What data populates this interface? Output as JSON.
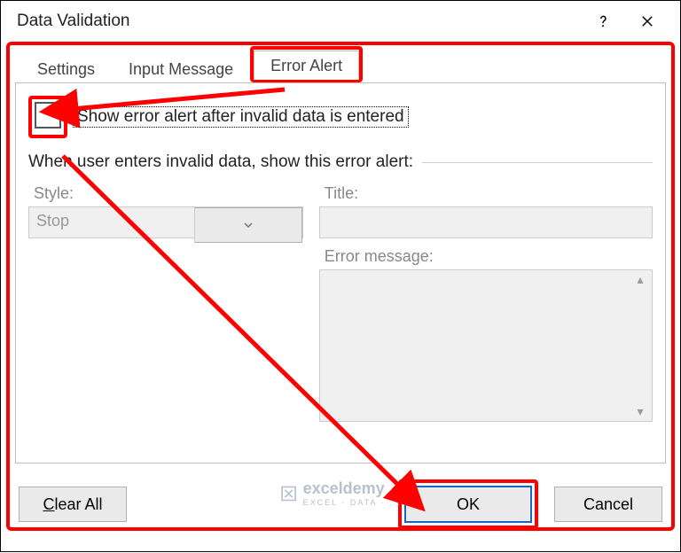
{
  "dialog": {
    "title": "Data Validation"
  },
  "tabs": {
    "settings": "Settings",
    "input_message": "Input Message",
    "error_alert": "Error Alert"
  },
  "checkbox": {
    "label": "Show error alert after invalid data is entered",
    "checked": false
  },
  "group": {
    "heading": "When user enters invalid data, show this error alert:",
    "style_label": "Style:",
    "style_value": "Stop",
    "title_label": "Title:",
    "title_value": "",
    "message_label": "Error message:",
    "message_value": ""
  },
  "buttons": {
    "clear_all_prefix": "C",
    "clear_all_rest": "lear All",
    "ok": "OK",
    "cancel": "Cancel"
  },
  "watermark": {
    "brand": "exceldemy",
    "tag": "EXCEL · DATA · ..."
  }
}
